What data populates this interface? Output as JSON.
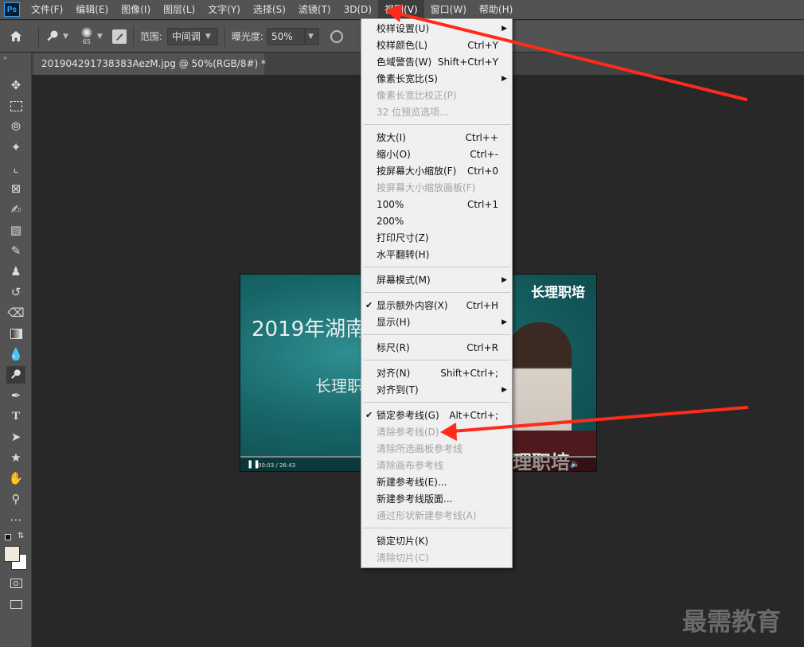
{
  "menubar": {
    "logo": "Ps",
    "items": [
      "文件(F)",
      "编辑(E)",
      "图像(I)",
      "图层(L)",
      "文字(Y)",
      "选择(S)",
      "滤镜(T)",
      "3D(D)",
      "视图(V)",
      "窗口(W)",
      "帮助(H)"
    ],
    "active_index": 8
  },
  "options": {
    "brush_size": "65",
    "range_label": "范围:",
    "range_value": "中间调",
    "exposure_label": "曝光度:",
    "exposure_value": "50%"
  },
  "document_tab": {
    "title": "201904291738383AezM.jpg @ 50%(RGB/8#) *"
  },
  "image": {
    "title": "2019年湖南",
    "subtitle": "长理职",
    "brand": "长理职培",
    "podium_text": "理职培",
    "time": "00:03 / 26:43"
  },
  "view_menu": {
    "sections": [
      [
        {
          "label": "校样设置(U)",
          "shortcut": "",
          "submenu": true,
          "enabled": true,
          "checked": false
        },
        {
          "label": "校样颜色(L)",
          "shortcut": "Ctrl+Y",
          "submenu": false,
          "enabled": true,
          "checked": false
        },
        {
          "label": "色域警告(W)",
          "shortcut": "Shift+Ctrl+Y",
          "submenu": false,
          "enabled": true,
          "checked": false
        },
        {
          "label": "像素长宽比(S)",
          "shortcut": "",
          "submenu": true,
          "enabled": true,
          "checked": false
        },
        {
          "label": "像素长宽比校正(P)",
          "shortcut": "",
          "submenu": false,
          "enabled": false,
          "checked": false
        },
        {
          "label": "32 位预览选项...",
          "shortcut": "",
          "submenu": false,
          "enabled": false,
          "checked": false
        }
      ],
      [
        {
          "label": "放大(I)",
          "shortcut": "Ctrl++",
          "submenu": false,
          "enabled": true,
          "checked": false
        },
        {
          "label": "缩小(O)",
          "shortcut": "Ctrl+-",
          "submenu": false,
          "enabled": true,
          "checked": false
        },
        {
          "label": "按屏幕大小缩放(F)",
          "shortcut": "Ctrl+0",
          "submenu": false,
          "enabled": true,
          "checked": false
        },
        {
          "label": "按屏幕大小缩放画板(F)",
          "shortcut": "",
          "submenu": false,
          "enabled": false,
          "checked": false
        },
        {
          "label": "100%",
          "shortcut": "Ctrl+1",
          "submenu": false,
          "enabled": true,
          "checked": false
        },
        {
          "label": "200%",
          "shortcut": "",
          "submenu": false,
          "enabled": true,
          "checked": false
        },
        {
          "label": "打印尺寸(Z)",
          "shortcut": "",
          "submenu": false,
          "enabled": true,
          "checked": false
        },
        {
          "label": "水平翻转(H)",
          "shortcut": "",
          "submenu": false,
          "enabled": true,
          "checked": false
        }
      ],
      [
        {
          "label": "屏幕模式(M)",
          "shortcut": "",
          "submenu": true,
          "enabled": true,
          "checked": false
        }
      ],
      [
        {
          "label": "显示额外内容(X)",
          "shortcut": "Ctrl+H",
          "submenu": false,
          "enabled": true,
          "checked": true
        },
        {
          "label": "显示(H)",
          "shortcut": "",
          "submenu": true,
          "enabled": true,
          "checked": false
        }
      ],
      [
        {
          "label": "标尺(R)",
          "shortcut": "Ctrl+R",
          "submenu": false,
          "enabled": true,
          "checked": false
        }
      ],
      [
        {
          "label": "对齐(N)",
          "shortcut": "Shift+Ctrl+;",
          "submenu": false,
          "enabled": true,
          "checked": false
        },
        {
          "label": "对齐到(T)",
          "shortcut": "",
          "submenu": true,
          "enabled": true,
          "checked": false
        }
      ],
      [
        {
          "label": "锁定参考线(G)",
          "shortcut": "Alt+Ctrl+;",
          "submenu": false,
          "enabled": true,
          "checked": true
        },
        {
          "label": "清除参考线(D)",
          "shortcut": "",
          "submenu": false,
          "enabled": false,
          "checked": false
        },
        {
          "label": "清除所选画板参考线",
          "shortcut": "",
          "submenu": false,
          "enabled": false,
          "checked": false
        },
        {
          "label": "清除画布参考线",
          "shortcut": "",
          "submenu": false,
          "enabled": false,
          "checked": false
        },
        {
          "label": "新建参考线(E)...",
          "shortcut": "",
          "submenu": false,
          "enabled": true,
          "checked": false
        },
        {
          "label": "新建参考线版面...",
          "shortcut": "",
          "submenu": false,
          "enabled": true,
          "checked": false
        },
        {
          "label": "通过形状新建参考线(A)",
          "shortcut": "",
          "submenu": false,
          "enabled": false,
          "checked": false
        }
      ],
      [
        {
          "label": "锁定切片(K)",
          "shortcut": "",
          "submenu": false,
          "enabled": true,
          "checked": false
        },
        {
          "label": "清除切片(C)",
          "shortcut": "",
          "submenu": false,
          "enabled": false,
          "checked": false
        }
      ]
    ]
  },
  "tools": [
    "move-icon",
    "marquee-icon",
    "lasso-icon",
    "magic-wand-icon",
    "crop-icon",
    "frame-icon",
    "eyedropper-icon",
    "healing-icon",
    "brush-icon",
    "stamp-icon",
    "history-brush-icon",
    "eraser-icon",
    "gradient-icon",
    "blur-icon",
    "dodge-icon",
    "pen-icon",
    "type-icon",
    "path-select-icon",
    "shape-icon",
    "hand-icon",
    "zoom-icon",
    "more-icon"
  ],
  "colors": {
    "foreground": "#f2ead9",
    "background": "#ffffff",
    "annotation_arrow": "#ff2a1a",
    "menu_bg": "#f0f0f0"
  },
  "watermark": "最需教育"
}
